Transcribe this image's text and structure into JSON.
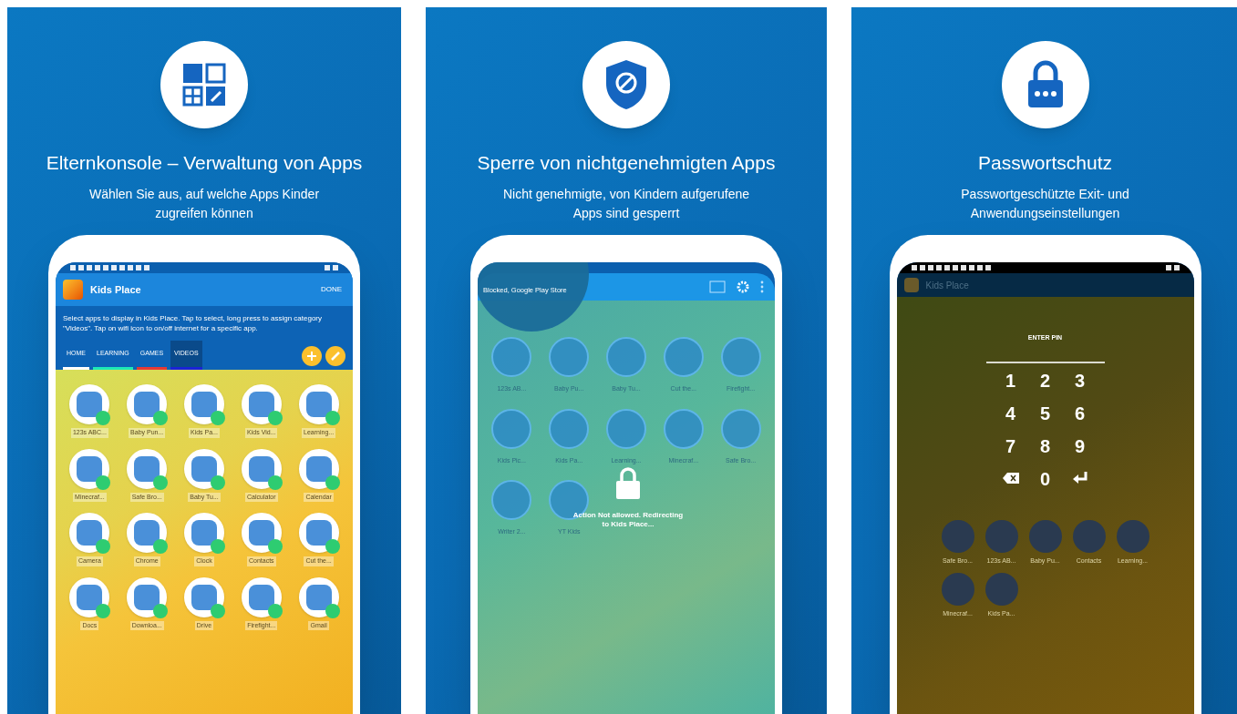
{
  "panels": [
    {
      "kind": "apps",
      "title": "Elternkonsole – Verwaltung von Apps",
      "subtitle": "Wählen Sie aus, auf welche Apps Kinder zugreifen können",
      "screen": {
        "kind": "picker",
        "app_title": "Kids Place",
        "action": "DONE",
        "description": "Select apps to display in Kids Place. Tap to select, long press to assign category \"Videos\". Tap on wifi icon to on/off internet for a specific app.",
        "tabs": [
          {
            "label": "HOME",
            "selected": false,
            "color": "#ffffff"
          },
          {
            "label": "LEARNING",
            "selected": false,
            "color": "#1de9b6"
          },
          {
            "label": "GAMES",
            "selected": false,
            "color": "#e53935"
          },
          {
            "label": "VIDEOS",
            "selected": true,
            "color": "#1a23d6"
          }
        ],
        "apps": [
          "123s ABC...",
          "Baby Pun...",
          "Kids Pa...",
          "Kids Vid...",
          "Learning...",
          "Minecraf...",
          "Safe Bro...",
          "Baby Tu...",
          "Calculator",
          "Calendar",
          "Camera",
          "Chrome",
          "Clock",
          "Contacts",
          "Cut the...",
          "Docs",
          "Downloa...",
          "Drive",
          "Firefight...",
          "Gmail"
        ]
      }
    },
    {
      "kind": "shield",
      "title": "Sperre von nichtgenehmigten Apps",
      "subtitle": "Nicht genehmigte, von Kindern aufgerufene Apps sind gesperrt",
      "screen": {
        "kind": "blocked",
        "magnifier": "Blocked, Google Play Store",
        "message": "Action Not allowed. Redirecting to Kids Place...",
        "apps": [
          "123s AB...",
          "Baby Pu...",
          "Baby Tu...",
          "Cut the...",
          "Firefight...",
          "Kids Pic...",
          "Kids Pa...",
          "Learning...",
          "Minecraf...",
          "Safe Bro...",
          "Writer 2...",
          "YT Kids"
        ]
      }
    },
    {
      "kind": "lock",
      "title": "Passwortschutz",
      "subtitle": "Passwortgeschützte Exit- und Anwendungseinstellungen",
      "screen": {
        "kind": "pin",
        "app_title": "Kids Place",
        "prompt": "ENTER PIN",
        "keys": [
          {
            "kind": "digit",
            "label": "1"
          },
          {
            "kind": "digit",
            "label": "2"
          },
          {
            "kind": "digit",
            "label": "3"
          },
          {
            "kind": "digit",
            "label": "4"
          },
          {
            "kind": "digit",
            "label": "5"
          },
          {
            "kind": "digit",
            "label": "6"
          },
          {
            "kind": "digit",
            "label": "7"
          },
          {
            "kind": "digit",
            "label": "8"
          },
          {
            "kind": "digit",
            "label": "9"
          },
          {
            "kind": "backspace"
          },
          {
            "kind": "digit",
            "label": "0"
          },
          {
            "kind": "enter"
          }
        ],
        "apps": [
          "Safe Bro...",
          "123s AB...",
          "Baby Pu...",
          "Contacts",
          "Learning...",
          "Minecraf...",
          "Kids Pa..."
        ]
      }
    }
  ]
}
